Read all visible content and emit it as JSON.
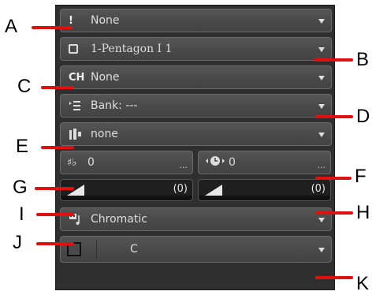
{
  "rows": {
    "A": {
      "icon": "exclamation-icon",
      "text": "None"
    },
    "B": {
      "icon": "pentagon-box-icon",
      "text": "1-Pentagon I 1"
    },
    "C": {
      "icon": "channel-icon",
      "icon_text": "CH",
      "text": "None"
    },
    "D": {
      "icon": "bank-list-icon",
      "text": "Bank: ---"
    },
    "E": {
      "icon": "instrument-icon",
      "text": "none"
    },
    "J": {
      "icon": "scale-icon",
      "text": "Chromatic"
    },
    "K": {
      "text": "C"
    }
  },
  "transpose": {
    "icon": "sharp-flat-icon",
    "value": "0",
    "more": "..."
  },
  "delay": {
    "icon": "clock-icon",
    "value": "0",
    "more": "..."
  },
  "slider_left": {
    "value_text": "(0)"
  },
  "slider_right": {
    "value_text": "(0)"
  },
  "callouts": {
    "A": "A",
    "B": "B",
    "C": "C",
    "D": "D",
    "E": "E",
    "F": "F",
    "G": "G",
    "H": "H",
    "I": "I",
    "J": "J",
    "K": "K"
  },
  "colors": {
    "callout_line": "#e01010",
    "panel": "#2f2f2f"
  }
}
